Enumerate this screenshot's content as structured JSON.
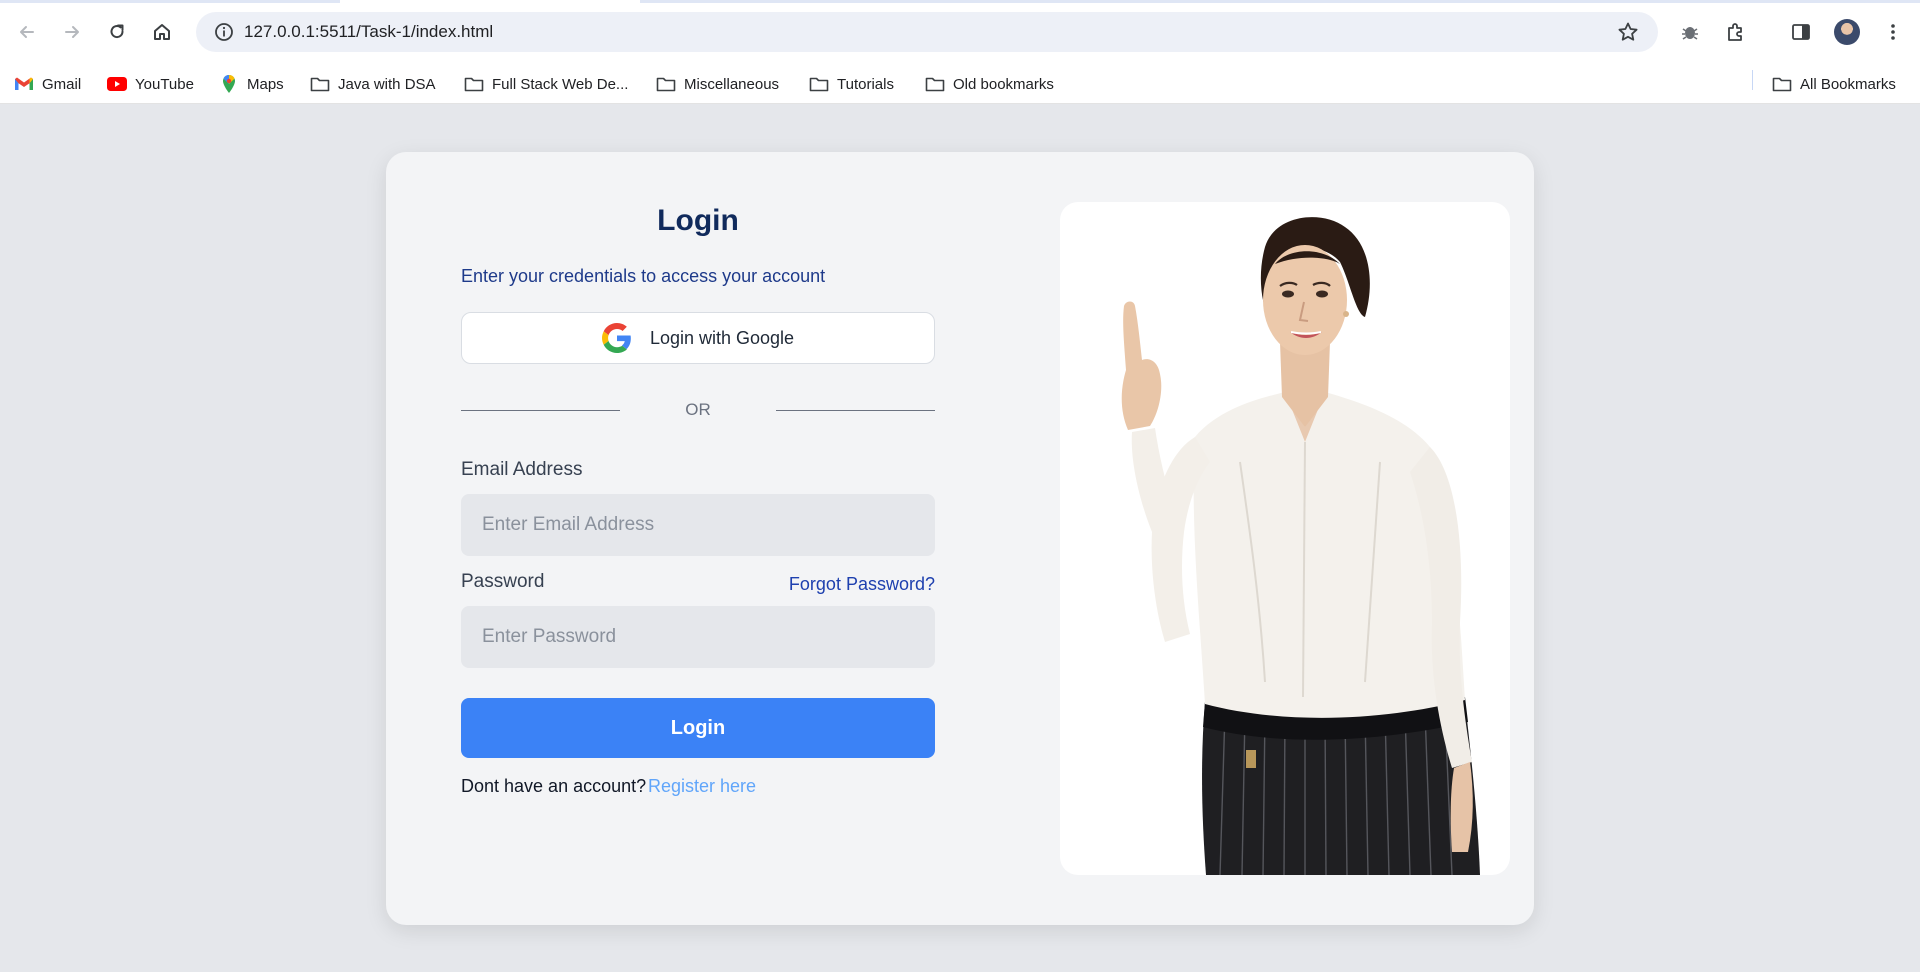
{
  "browser": {
    "url": "127.0.0.1:5511/Task-1/index.html",
    "bookmarks": [
      {
        "label": "Gmail",
        "icon": "gmail-icon"
      },
      {
        "label": "YouTube",
        "icon": "youtube-icon"
      },
      {
        "label": "Maps",
        "icon": "maps-icon"
      },
      {
        "label": "Java with DSA",
        "icon": "folder-icon"
      },
      {
        "label": "Full Stack Web De...",
        "icon": "folder-icon"
      },
      {
        "label": "Miscellaneous",
        "icon": "folder-icon"
      },
      {
        "label": "Tutorials",
        "icon": "folder-icon"
      },
      {
        "label": "Old bookmarks",
        "icon": "folder-icon"
      }
    ],
    "all_bookmarks": "All Bookmarks"
  },
  "login": {
    "title": "Login",
    "subtitle": "Enter your credentials to access your account",
    "google_label": "Login with Google",
    "or_text": "OR",
    "email_label": "Email Address",
    "email_placeholder": "Enter Email Address",
    "password_label": "Password",
    "password_placeholder": "Enter Password",
    "forgot_label": "Forgot Password?",
    "submit_label": "Login",
    "footer_text": "Dont have an account?",
    "register_label": "Register here"
  },
  "colors": {
    "page_bg": "#e5e7eb",
    "card_bg": "#f3f4f6",
    "title": "#102a5c",
    "primary": "#3b82f6",
    "link": "#1e40af",
    "register_link": "#60a5fa"
  }
}
